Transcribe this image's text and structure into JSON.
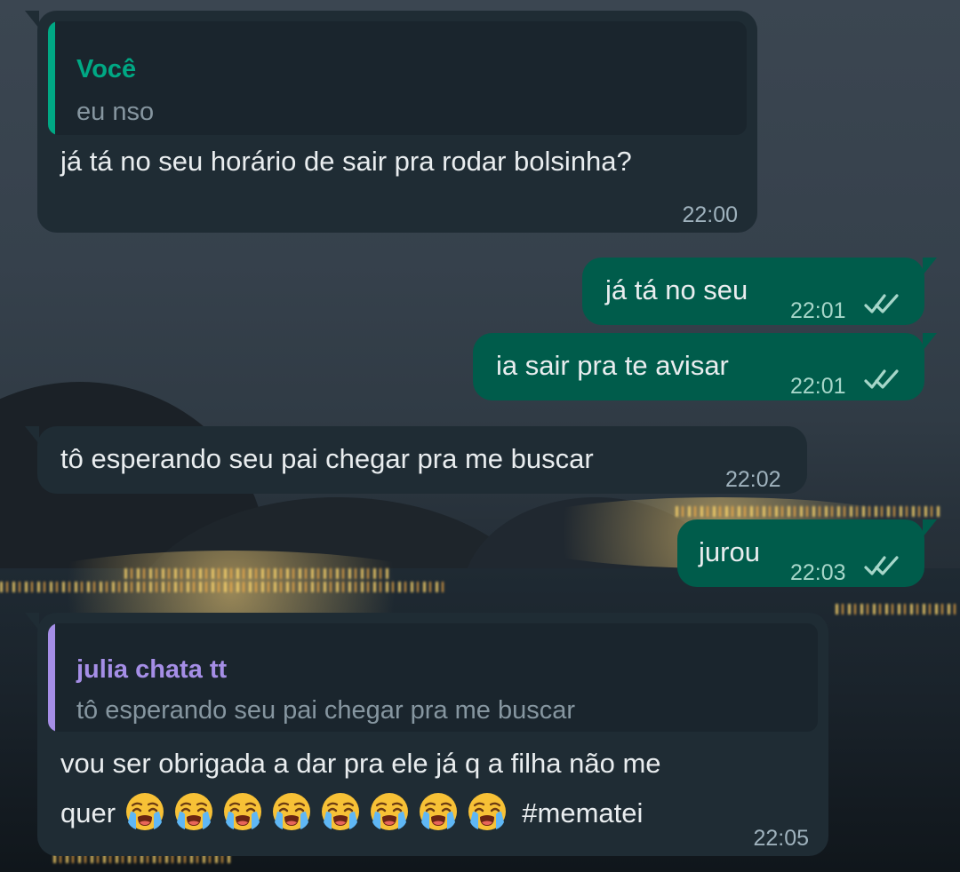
{
  "chat": {
    "messages": [
      {
        "direction": "incoming",
        "quote": {
          "author": "Você",
          "text": "eu nso"
        },
        "text": "já tá no seu horário de sair pra rodar bolsinha?",
        "time": "22:00"
      },
      {
        "direction": "outgoing",
        "text": "já tá no seu",
        "time": "22:01",
        "status": "read"
      },
      {
        "direction": "outgoing",
        "text": "ia sair pra te avisar",
        "time": "22:01",
        "status": "read"
      },
      {
        "direction": "incoming",
        "text": "tô esperando seu pai chegar pra me buscar",
        "time": "22:02"
      },
      {
        "direction": "outgoing",
        "text": "jurou",
        "time": "22:03",
        "status": "read"
      },
      {
        "direction": "incoming",
        "quote": {
          "author": "julia chata tt",
          "text": "tô esperando seu pai chegar pra me buscar"
        },
        "text_line1": "vou ser obrigada a dar pra ele já q a filha não me",
        "text_line2_prefix": "quer",
        "emoji": "loudly-crying-face",
        "emoji_count": 8,
        "text_line2_suffix": "#mematei",
        "time": "22:05"
      }
    ]
  },
  "colors": {
    "incoming_bubble": "#1f2c34",
    "outgoing_bubble": "#005c4b",
    "quote_you": "#00a884",
    "quote_contact": "#a58ee6",
    "read_ticks": "#a6d6c9"
  }
}
